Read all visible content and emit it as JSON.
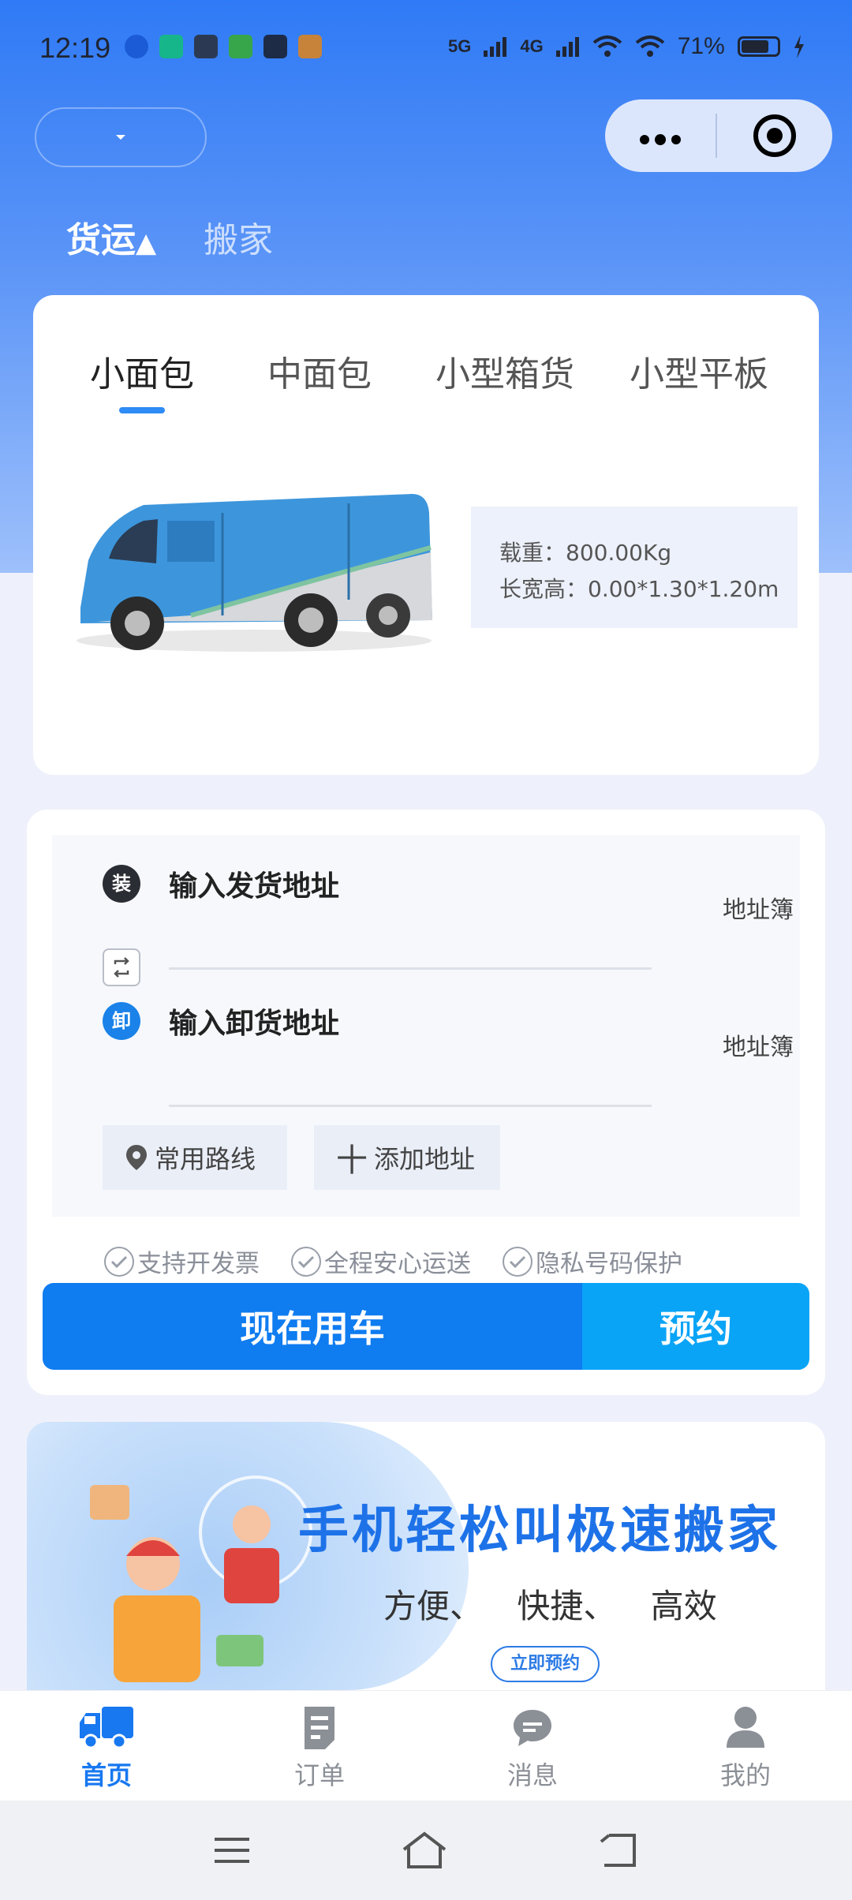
{
  "status_bar": {
    "time": "12:19",
    "signal_1": "5G",
    "signal_2": "4G",
    "battery": "71%"
  },
  "header": {
    "city_value": "",
    "capsule_more": "•••"
  },
  "service_tabs": [
    {
      "label": "货运",
      "active": true,
      "indicator": "▲"
    },
    {
      "label": "搬家",
      "active": false
    }
  ],
  "vehicle": {
    "tabs": [
      {
        "label": "小面包",
        "active": true
      },
      {
        "label": "中面包",
        "active": false
      },
      {
        "label": "小型箱货",
        "active": false
      },
      {
        "label": "小型平板",
        "active": false
      }
    ],
    "load": "载重：800.00Kg",
    "dimensions": "长宽高：0.00*1.30*1.20m"
  },
  "address": {
    "pickup_badge": "装",
    "pickup_placeholder": "输入发货地址",
    "dropoff_badge": "卸",
    "dropoff_placeholder": "输入卸货地址",
    "address_book": "地址簿",
    "common_routes": "常用路线",
    "add_address": "添加地址",
    "add_symbol": "十"
  },
  "guarantees": [
    "支持开发票",
    "全程安心运送",
    "隐私号码保护"
  ],
  "actions": {
    "use_now": "现在用车",
    "reserve": "预约"
  },
  "banner": {
    "headline": "手机轻松叫极速搬家",
    "subtitle": "方便、 快捷、 高效",
    "cta": "立即预约"
  },
  "bottom_nav": [
    {
      "label": "首页",
      "icon": "truck-icon",
      "active": true
    },
    {
      "label": "订单",
      "icon": "order-doc-icon",
      "active": false
    },
    {
      "label": "消息",
      "icon": "message-bubble-icon",
      "active": false
    },
    {
      "label": "我的",
      "icon": "person-icon",
      "active": false
    }
  ],
  "colors": {
    "primary": "#0f7cf0",
    "secondary": "#0aa4f7",
    "active_nav": "#1878f0",
    "header_gradient_top": "#2f7af6"
  }
}
